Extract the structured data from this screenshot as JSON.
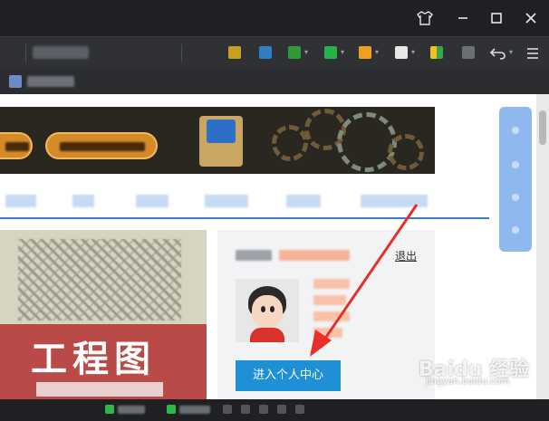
{
  "window": {
    "skin_icon": "tshirt-icon",
    "minimize_icon": "minimize-icon",
    "maximize_icon": "maximize-icon",
    "close_icon": "close-icon",
    "minimize_glyph": "—",
    "maximize_glyph": "☐",
    "close_glyph": "✕",
    "skin_glyph": "👕"
  },
  "toolbar": {
    "undo_icon": "undo-icon",
    "undo_glyph": "↶",
    "menu_icon": "menu-icon",
    "menu_glyph": "≡",
    "icon_colors": [
      "#c8a020",
      "#2f7fc4",
      "#2f9a3a",
      "#26b34a",
      "#f0a020",
      "#e8e8e8",
      "#f2c21a",
      "#6c6f74"
    ]
  },
  "page": {
    "nav_underline_color": "#3a7bd5",
    "user_panel": {
      "logout_label": "退出",
      "enter_button_label": "进入个人中心"
    },
    "article": {
      "title": "工程图"
    }
  },
  "watermark": {
    "brand": "Baidu 经验",
    "url": "jingyan.baidu.com"
  },
  "accent_colors": {
    "button": "#1f8fd6",
    "arrow": "#e8302a"
  }
}
